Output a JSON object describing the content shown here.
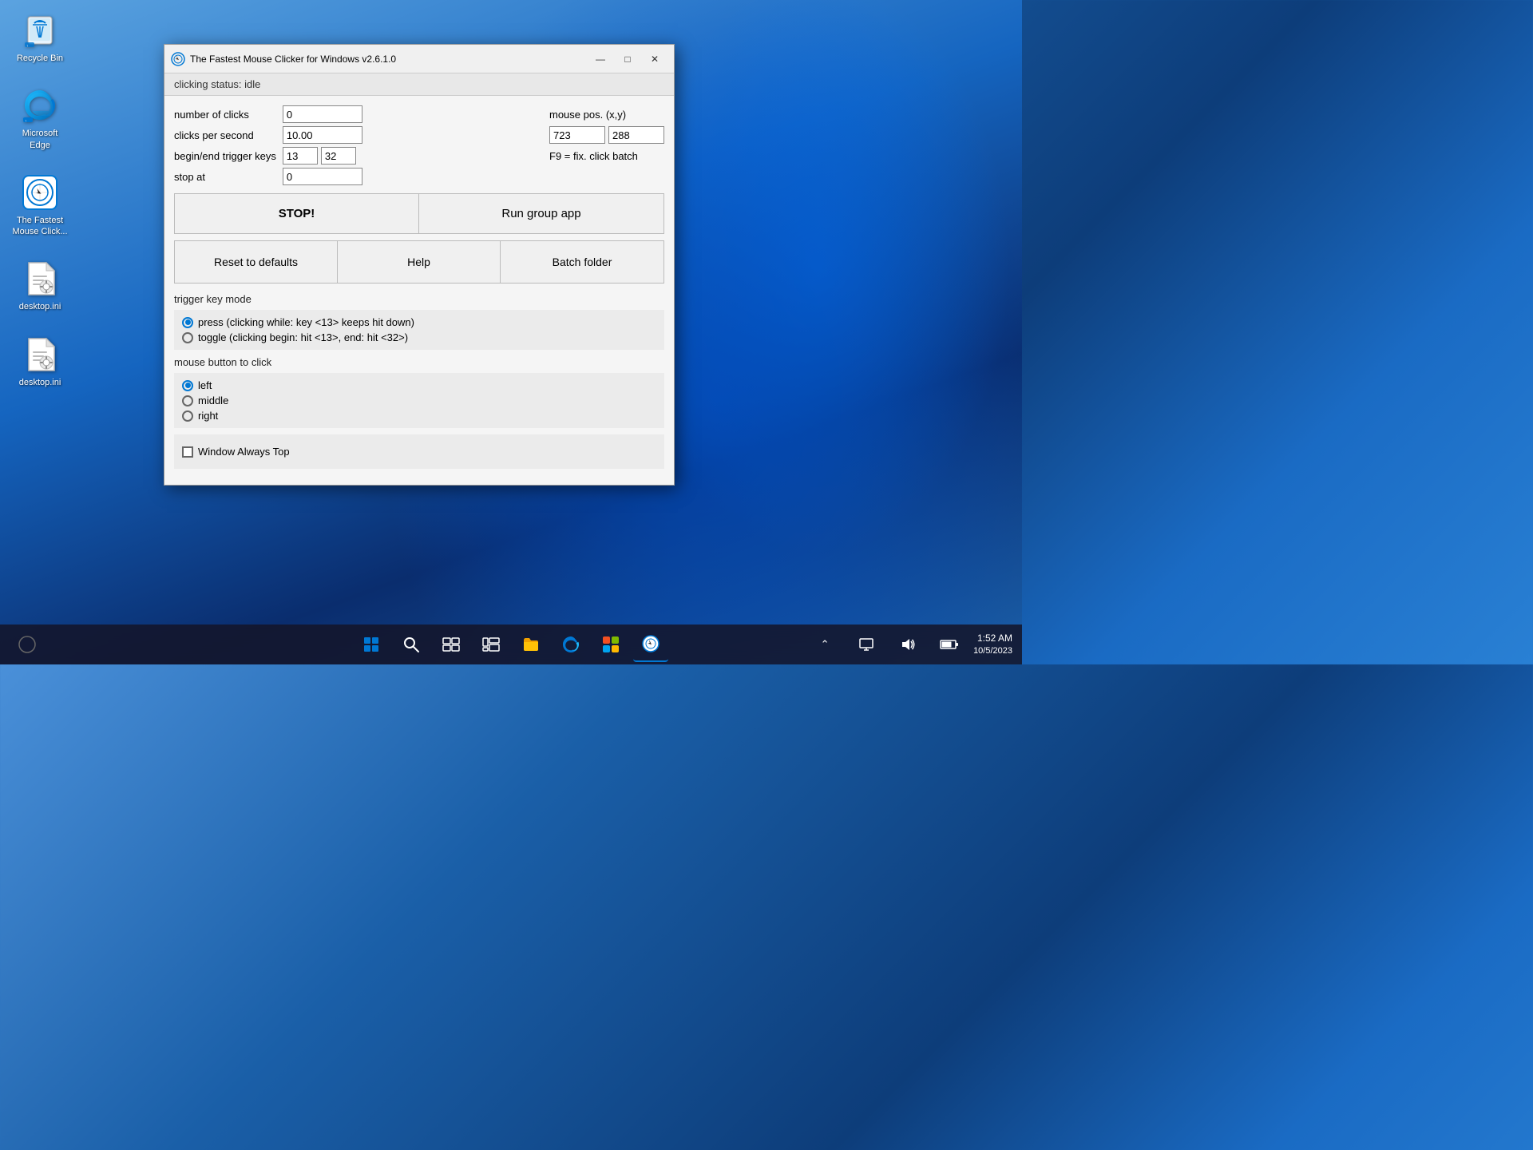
{
  "desktop": {
    "icons": [
      {
        "id": "recycle-bin",
        "label": "Recycle Bin",
        "type": "recycle"
      },
      {
        "id": "microsoft-edge",
        "label": "Microsoft Edge",
        "type": "edge"
      },
      {
        "id": "mouse-clicker",
        "label": "The Fastest Mouse Click...",
        "type": "clicker"
      },
      {
        "id": "desktop-ini-1",
        "label": "desktop.ini",
        "type": "file"
      },
      {
        "id": "desktop-ini-2",
        "label": "desktop.ini",
        "type": "file"
      }
    ]
  },
  "window": {
    "title": "The Fastest Mouse Clicker for Windows v2.6.1.0",
    "status": "clicking status: idle",
    "fields": {
      "number_of_clicks_label": "number of clicks",
      "number_of_clicks_value": "0",
      "clicks_per_second_label": "clicks per second",
      "clicks_per_second_value": "10.00",
      "begin_end_trigger_label": "begin/end trigger keys",
      "begin_trigger_value": "13",
      "end_trigger_value": "32",
      "stop_at_label": "stop at",
      "stop_at_value": "0",
      "mouse_pos_label": "mouse pos. (x,y)",
      "mouse_x_value": "723",
      "mouse_y_value": "288",
      "f9_label": "F9 = fix. click batch"
    },
    "buttons": {
      "stop": "STOP!",
      "run_group": "Run group app",
      "reset": "Reset to defaults",
      "help": "Help",
      "batch_folder": "Batch folder"
    },
    "trigger_key_mode": {
      "label": "trigger key mode",
      "options": [
        {
          "id": "press",
          "label": "press (clicking while: key <13> keeps hit down)",
          "checked": true
        },
        {
          "id": "toggle",
          "label": "toggle (clicking begin: hit <13>, end: hit <32>)",
          "checked": false
        }
      ]
    },
    "mouse_button": {
      "label": "mouse button to click",
      "options": [
        {
          "id": "left",
          "label": "left",
          "checked": true
        },
        {
          "id": "middle",
          "label": "middle",
          "checked": false
        },
        {
          "id": "right",
          "label": "right",
          "checked": false
        }
      ]
    },
    "window_always_top": {
      "label": "Window Always Top",
      "checked": false
    }
  },
  "taskbar": {
    "items": [
      {
        "id": "start",
        "type": "start"
      },
      {
        "id": "search",
        "type": "search"
      },
      {
        "id": "task-view",
        "type": "taskview"
      },
      {
        "id": "widgets",
        "type": "widgets"
      },
      {
        "id": "explorer",
        "type": "explorer"
      },
      {
        "id": "edge",
        "type": "edge"
      },
      {
        "id": "ms-store",
        "type": "store"
      },
      {
        "id": "mouse-clicker-tb",
        "type": "clicker",
        "active": true
      }
    ],
    "tray": {
      "show_hidden": "^",
      "display": "□",
      "volume": "🔊",
      "battery": "🔋"
    },
    "clock": {
      "time": "1:52 AM",
      "date": "10/5/2023"
    }
  }
}
